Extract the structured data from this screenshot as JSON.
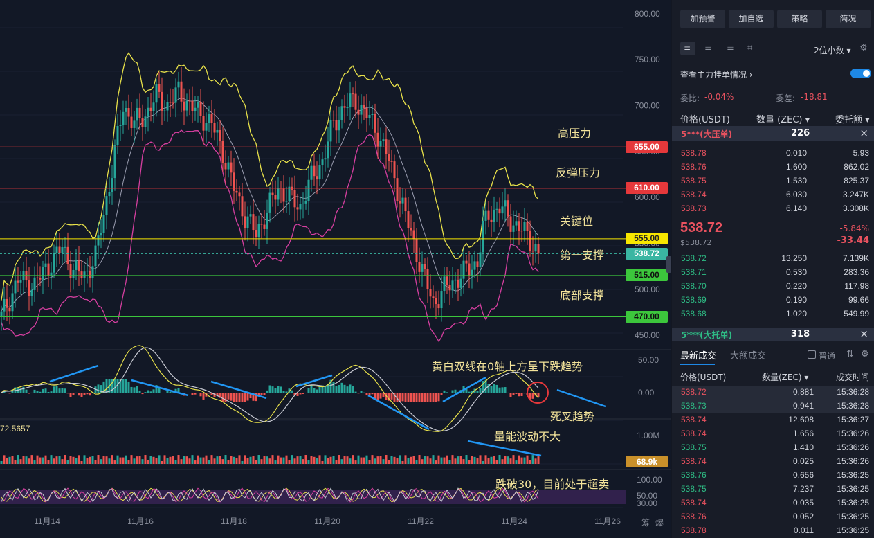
{
  "chart_data": {
    "type": "candlestick",
    "x_axis": {
      "labels": [
        "11月14",
        "11月16",
        "11月18",
        "11月20",
        "11月22",
        "11月24",
        "11月26"
      ]
    },
    "price_axis": {
      "labels": [
        "800.00",
        "750.00",
        "700.00",
        "650.00",
        "600.00",
        "550.00",
        "500.00",
        "450.00"
      ]
    },
    "price_range": [
      438,
      815
    ],
    "current_price": 538.72,
    "levels": [
      {
        "price": 655.0,
        "label": "655.00",
        "color": "#e5383b",
        "annotation": "高压力"
      },
      {
        "price": 610.0,
        "label": "610.00",
        "color": "#e5383b",
        "annotation": "反弹压力"
      },
      {
        "price": 555.0,
        "label": "555.00",
        "color": "#f7e600",
        "annotation": "关键位"
      },
      {
        "price": 515.0,
        "label": "515.00",
        "color": "#3cc63c",
        "annotation": "第一支撑"
      },
      {
        "price": 470.0,
        "label": "470.00",
        "color": "#3cc63c",
        "annotation": "底部支撑"
      }
    ],
    "price_closes": [
      [
        0,
        470
      ],
      [
        6,
        510
      ],
      [
        12,
        505
      ],
      [
        18,
        530
      ],
      [
        22,
        545
      ],
      [
        26,
        520
      ],
      [
        30,
        515
      ],
      [
        34,
        535
      ],
      [
        40,
        630
      ],
      [
        44,
        700
      ],
      [
        48,
        680
      ],
      [
        52,
        690
      ],
      [
        56,
        710
      ],
      [
        60,
        700
      ],
      [
        64,
        715
      ],
      [
        68,
        700
      ],
      [
        72,
        690
      ],
      [
        76,
        680
      ],
      [
        80,
        650
      ],
      [
        84,
        610
      ],
      [
        88,
        580
      ],
      [
        92,
        560
      ],
      [
        96,
        585
      ],
      [
        100,
        610
      ],
      [
        104,
        600
      ],
      [
        108,
        590
      ],
      [
        112,
        620
      ],
      [
        116,
        640
      ],
      [
        120,
        680
      ],
      [
        124,
        700
      ],
      [
        128,
        705
      ],
      [
        132,
        690
      ],
      [
        136,
        670
      ],
      [
        140,
        640
      ],
      [
        144,
        600
      ],
      [
        148,
        560
      ],
      [
        152,
        520
      ],
      [
        156,
        485
      ],
      [
        160,
        500
      ],
      [
        164,
        510
      ],
      [
        168,
        520
      ],
      [
        172,
        530
      ],
      [
        174,
        565
      ],
      [
        176,
        580
      ],
      [
        180,
        590
      ],
      [
        184,
        575
      ],
      [
        188,
        565
      ],
      [
        192,
        550
      ],
      [
        194,
        538.72
      ]
    ],
    "macd_axis": [
      "50.00",
      "0.00"
    ],
    "volume_axis": [
      "1.00M"
    ],
    "volume_last": "68.9k",
    "rsi_axis": [
      "100.00",
      "50.00",
      "30.00"
    ],
    "macd_left_label": "72.5657",
    "annotations": [
      "黄白双线在0轴上方呈下跌趋势",
      "死叉趋势",
      "量能波动不大",
      "跌破30，目前处于超卖"
    ],
    "bottom_right": [
      "筹",
      "爆"
    ]
  },
  "side_panel": {
    "buttons": [
      "加预警",
      "加自选",
      "策略",
      "简况"
    ],
    "precision": "2位小数",
    "main_orders_label": "查看主力挂单情况",
    "weibi_label": "委比:",
    "weibi_value": "-0.04%",
    "weicha_label": "委差:",
    "weicha_value": "-18.81",
    "headers": [
      "价格(USDT)",
      "数量 (ZEC)",
      "委托额"
    ],
    "big_ask": {
      "label": "5***(大压单)",
      "value": "226"
    },
    "asks": [
      [
        "538.78",
        "0.010",
        "5.93"
      ],
      [
        "538.76",
        "1.600",
        "862.02"
      ],
      [
        "538.75",
        "1.530",
        "825.37"
      ],
      [
        "538.74",
        "6.030",
        "3.247K"
      ],
      [
        "538.73",
        "6.140",
        "3.308K"
      ]
    ],
    "last_price": "538.72",
    "last_usd": "$538.72",
    "change_pct": "-5.84%",
    "change_abs": "-33.44",
    "bids": [
      [
        "538.72",
        "13.250",
        "7.139K"
      ],
      [
        "538.71",
        "0.530",
        "283.36"
      ],
      [
        "538.70",
        "0.220",
        "117.98"
      ],
      [
        "538.69",
        "0.190",
        "99.66"
      ],
      [
        "538.68",
        "1.020",
        "549.99"
      ]
    ],
    "big_bid": {
      "label": "5***(大托单)",
      "value": "318"
    },
    "trades_tab_active": "最新成交",
    "trades_tab_other": "大额成交",
    "trades_filter": "普通",
    "trade_headers": [
      "价格(USDT)",
      "数量(ZEC)",
      "成交时间"
    ],
    "trades": [
      [
        "538.72",
        "0.881",
        "15:36:28",
        "sell"
      ],
      [
        "538.73",
        "0.941",
        "15:36:28",
        "buy"
      ],
      [
        "538.74",
        "12.608",
        "15:36:27",
        "sell"
      ],
      [
        "538.74",
        "1.656",
        "15:36:26",
        "sell"
      ],
      [
        "538.75",
        "1.410",
        "15:36:26",
        "buy"
      ],
      [
        "538.74",
        "0.025",
        "15:36:26",
        "sell"
      ],
      [
        "538.76",
        "0.656",
        "15:36:25",
        "buy"
      ],
      [
        "538.75",
        "7.237",
        "15:36:25",
        "buy"
      ],
      [
        "538.74",
        "0.035",
        "15:36:25",
        "sell"
      ],
      [
        "538.76",
        "0.052",
        "15:36:25",
        "sell"
      ],
      [
        "538.78",
        "0.011",
        "15:36:25",
        "sell"
      ]
    ]
  }
}
